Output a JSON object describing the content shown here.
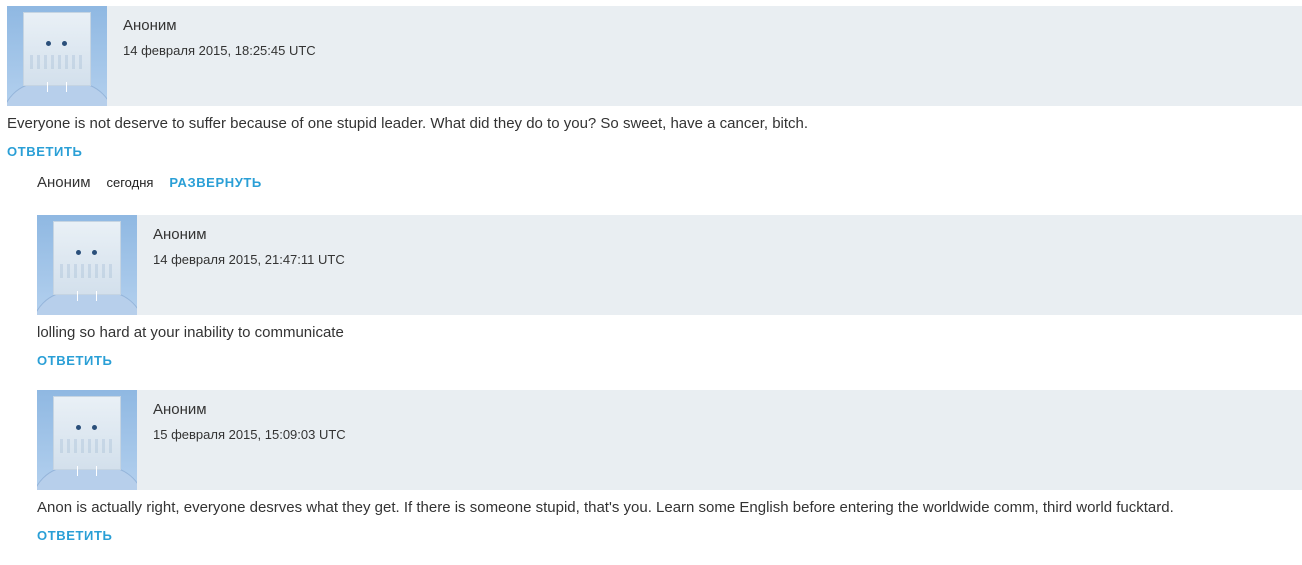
{
  "comments": [
    {
      "author": "Аноним",
      "timestamp": "14 февраля 2015, 18:25:45 UTC",
      "text": "Everyone is not deserve to suffer because of one stupid leader. What did they do to you? So sweet, have a cancer, bitch.",
      "reply_label": "ОТВЕТИТЬ"
    },
    {
      "author": "Аноним",
      "timestamp": "14 февраля 2015, 21:47:11 UTC",
      "text": "lolling so hard at your inability to communicate",
      "reply_label": "ОТВЕТИТЬ"
    },
    {
      "author": "Аноним",
      "timestamp": "15 февраля 2015, 15:09:03 UTC",
      "text": "Anon is actually right, everyone desrves what they get. If there is someone stupid, that's you. Learn some English before entering the worldwide comm, third world fucktard.",
      "reply_label": "ОТВЕТИТЬ"
    }
  ],
  "collapsed_comment": {
    "author": "Аноним",
    "date": "сегодня",
    "expand_label": "РАЗВЕРНУТЬ"
  },
  "colors": {
    "header_bg": "#e9eef2",
    "link": "#2a9fd6",
    "text": "#333333"
  },
  "avatar_icon": "anonymous-paper-bag-avatar-icon"
}
